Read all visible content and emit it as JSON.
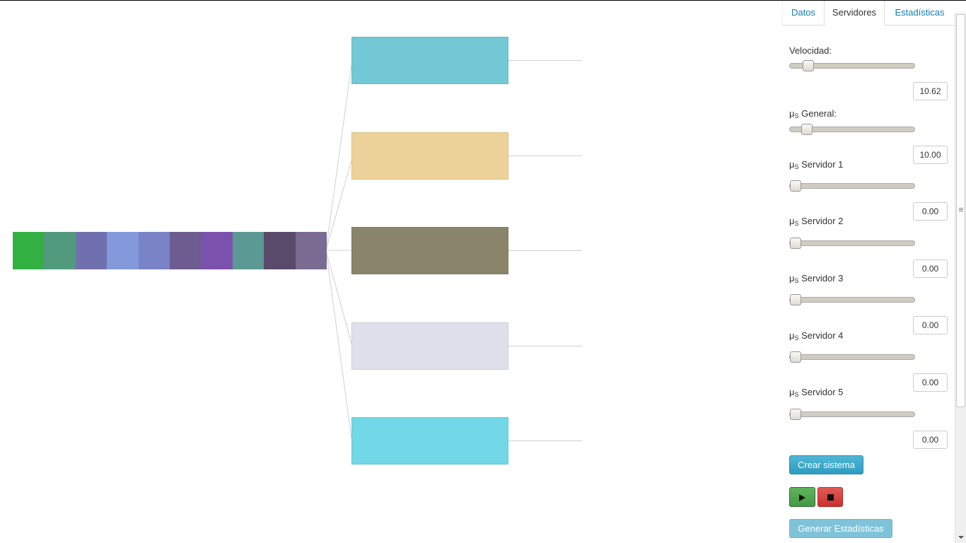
{
  "tabs": [
    {
      "label": "Datos",
      "active": false
    },
    {
      "label": "Servidores",
      "active": true
    },
    {
      "label": "Estadísticas",
      "active": false
    }
  ],
  "controls": {
    "velocidad": {
      "label": "Velocidad:",
      "value": "10.62",
      "fraction": 0.11
    },
    "mu_general": {
      "mu": "μ",
      "sub": "S",
      "label": " General:",
      "value": "10.00",
      "fraction": 0.1
    },
    "servers": [
      {
        "mu": "μ",
        "sub": "S",
        "label": " Servidor 1",
        "value": "0.00",
        "fraction": 0.0
      },
      {
        "mu": "μ",
        "sub": "S",
        "label": " Servidor 2",
        "value": "0.00",
        "fraction": 0.0
      },
      {
        "mu": "μ",
        "sub": "S",
        "label": " Servidor 3",
        "value": "0.00",
        "fraction": 0.0
      },
      {
        "mu": "μ",
        "sub": "S",
        "label": " Servidor 4",
        "value": "0.00",
        "fraction": 0.0
      },
      {
        "mu": "μ",
        "sub": "S",
        "label": " Servidor 5",
        "value": "0.00",
        "fraction": 0.0
      }
    ]
  },
  "buttons": {
    "create": "Crear sistema",
    "stats": "Generar Estadísticas",
    "play_icon": "play-icon",
    "stop_icon": "stop-icon"
  },
  "simulation": {
    "queue_colors": [
      "#33b042",
      "#529a7d",
      "#7070ae",
      "#8299dc",
      "#7a83c6",
      "#6c5c8f",
      "#7a51ad",
      "#5b9994",
      "#594a6a",
      "#7a6b93"
    ],
    "server_colors": [
      "#72c9d5",
      "#ecd298",
      "#8a846a",
      "#dfe0ec",
      "#72d8e7"
    ],
    "link_color": "#d0d0d0"
  }
}
